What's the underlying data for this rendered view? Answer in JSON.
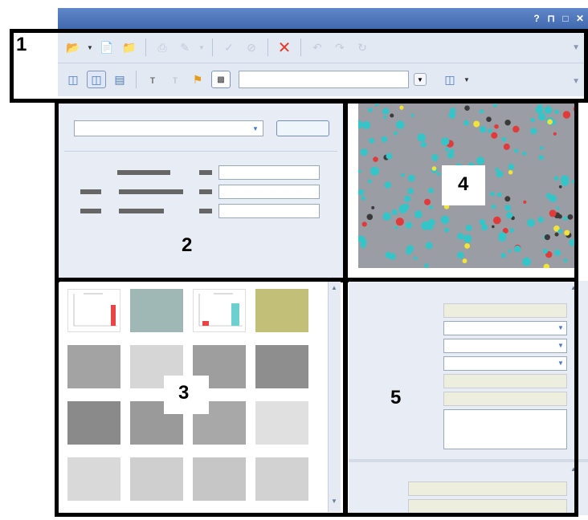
{
  "window": {
    "controls": [
      "?",
      "⊓",
      "□",
      "✕"
    ]
  },
  "toolbar": {
    "row1_icons": [
      "folder-open",
      "dropdown-arrow",
      "new-doc",
      "folder-add",
      "separator",
      "disabled-a",
      "disabled-b",
      "dropdown-arrow",
      "separator",
      "check",
      "cancel-circle",
      "separator",
      "delete",
      "separator",
      "undo-a",
      "undo-b",
      "undo-c"
    ],
    "row2_icons": [
      "layout-a",
      "layout-b",
      "layout-c",
      "separator",
      "filter",
      "filter-disabled",
      "tag-color",
      "tag-box"
    ],
    "search_value": ""
  },
  "callouts": {
    "one": "1",
    "two": "2",
    "three": "3",
    "four": "4",
    "five": "5"
  },
  "colors": {
    "title_gradient": "#4a73b8",
    "toolbar_bg": "#e3e9f3",
    "panel_bg": "#e8edf5",
    "readonly_bg": "#eeeede",
    "cyan_particles": "#35c4c8",
    "red_particles": "#e03a3a",
    "yellow_particles": "#f2e33a"
  }
}
